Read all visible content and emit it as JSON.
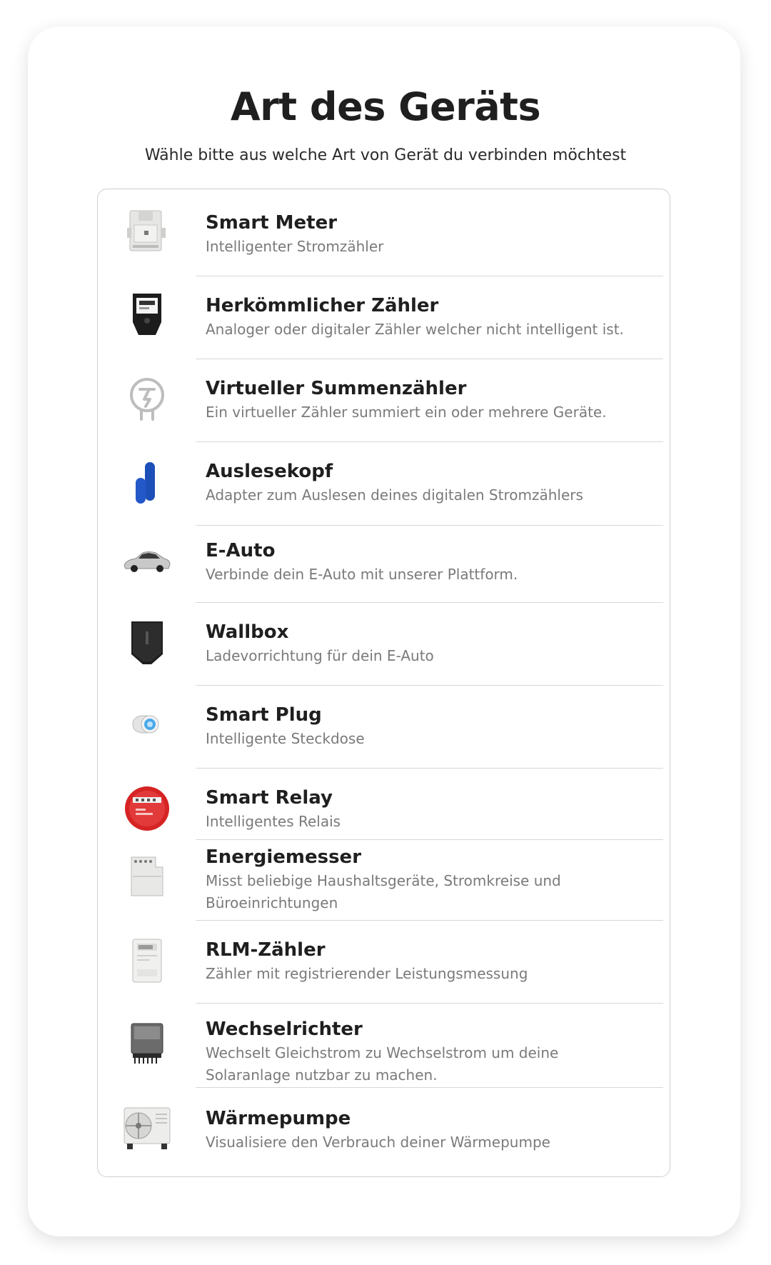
{
  "header": {
    "title": "Art des Geräts",
    "subtitle": "Wähle bitte aus welche Art von Gerät du verbinden möchtest"
  },
  "devices": [
    {
      "name": "Smart Meter",
      "description": "Intelligenter Stromzähler",
      "icon": "smart-meter-icon"
    },
    {
      "name": "Herkömmlicher Zähler",
      "description": "Analoger oder digitaler Zähler welcher nicht intelligent ist.",
      "icon": "conventional-meter-icon"
    },
    {
      "name": "Virtueller Summenzähler",
      "description": "Ein virtueller Zähler summiert ein oder mehrere Geräte.",
      "icon": "virtual-meter-icon"
    },
    {
      "name": "Auslesekopf",
      "description": "Adapter zum Auslesen deines digitalen Stromzählers",
      "icon": "reading-head-icon"
    },
    {
      "name": "E-Auto",
      "description": "Verbinde dein E-Auto mit unserer Plattform.",
      "icon": "electric-car-icon"
    },
    {
      "name": "Wallbox",
      "description": "Ladevorrichtung für dein E-Auto",
      "icon": "wallbox-icon"
    },
    {
      "name": "Smart Plug",
      "description": "Intelligente Steckdose",
      "icon": "smart-plug-icon"
    },
    {
      "name": "Smart Relay",
      "description": "Intelligentes Relais",
      "icon": "smart-relay-icon"
    },
    {
      "name": "Energiemesser",
      "description": "Misst beliebige Haushaltsgeräte, Stromkreise und Büroeinrichtungen",
      "icon": "energy-meter-icon"
    },
    {
      "name": "RLM-Zähler",
      "description": "Zähler mit registrierender Leistungsmessung",
      "icon": "rlm-meter-icon"
    },
    {
      "name": "Wechselrichter",
      "description": "Wechselt Gleichstrom zu Wechselstrom um deine Solaranlage nutzbar zu machen.",
      "icon": "inverter-icon"
    },
    {
      "name": "Wärmepumpe",
      "description": "Visualisiere den Verbrauch deiner Wärmepumpe",
      "icon": "heat-pump-icon"
    }
  ]
}
